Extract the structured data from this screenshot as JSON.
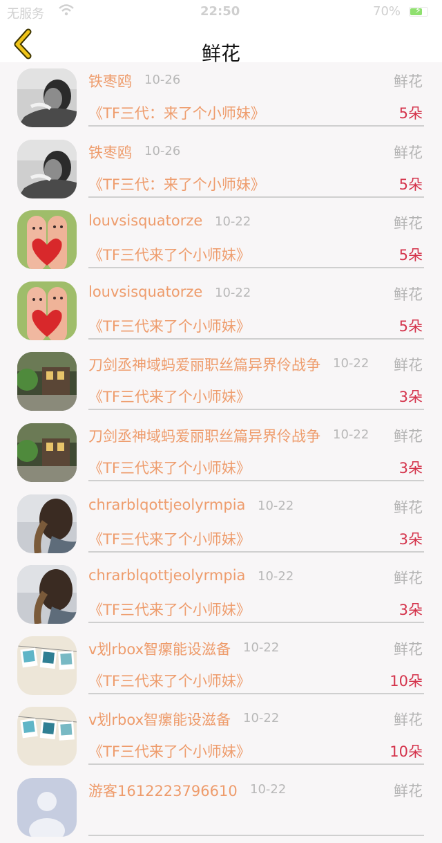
{
  "status_bar": {
    "carrier": "无服务",
    "time": "22:50",
    "battery_pct": "70%",
    "battery_level": 0.7
  },
  "nav": {
    "back_icon": "chevron-left-icon",
    "title": "鲜花",
    "accent": "#f0c419"
  },
  "colors": {
    "name": "#ee9c6c",
    "count": "#d4334b",
    "muted": "#b4b4b4"
  },
  "items": [
    {
      "user": "铁枣鸥",
      "date": "10-26",
      "type": "鲜花",
      "title": "《TF三代：来了个小师妹》",
      "count": "5朵",
      "avatar": "portrait-bw"
    },
    {
      "user": "铁枣鸥",
      "date": "10-26",
      "type": "鲜花",
      "title": "《TF三代：来了个小师妹》",
      "count": "5朵",
      "avatar": "portrait-bw"
    },
    {
      "user": "louvsisquatorze",
      "date": "10-22",
      "type": "鲜花",
      "title": "《TF三代来了个小师妹》",
      "count": "5朵",
      "avatar": "fingers-heart"
    },
    {
      "user": "louvsisquatorze",
      "date": "10-22",
      "type": "鲜花",
      "title": "《TF三代来了个小师妹》",
      "count": "5朵",
      "avatar": "fingers-heart"
    },
    {
      "user": "刀剑丞神域蚂爱丽职丝篇异界伶战争",
      "date": "10-22",
      "type": "鲜花",
      "title": "《TF三代来了个小师妹》",
      "count": "3朵",
      "avatar": "garden-house"
    },
    {
      "user": "刀剑丞神域蚂爱丽职丝篇异界伶战争",
      "date": "10-22",
      "type": "鲜花",
      "title": "《TF三代来了个小师妹》",
      "count": "3朵",
      "avatar": "garden-house"
    },
    {
      "user": "chrarblqottjeolyrmpia",
      "date": "10-22",
      "type": "鲜花",
      "title": "《TF三代来了个小师妹》",
      "count": "3朵",
      "avatar": "girl-braid"
    },
    {
      "user": "chrarblqottjeolyrmpia",
      "date": "10-22",
      "type": "鲜花",
      "title": "《TF三代来了个小师妹》",
      "count": "3朵",
      "avatar": "girl-braid"
    },
    {
      "user": "v划rbox智瘰能设滋备",
      "date": "10-22",
      "type": "鲜花",
      "title": "《TF三代来了个小师妹》",
      "count": "10朵",
      "avatar": "photo-clips"
    },
    {
      "user": "v划rbox智瘰能设滋备",
      "date": "10-22",
      "type": "鲜花",
      "title": "《TF三代来了个小师妹》",
      "count": "10朵",
      "avatar": "photo-clips"
    },
    {
      "user": "游客1612223796610",
      "date": "10-22",
      "type": "鲜花",
      "title": "",
      "count": "",
      "avatar": "default"
    }
  ]
}
